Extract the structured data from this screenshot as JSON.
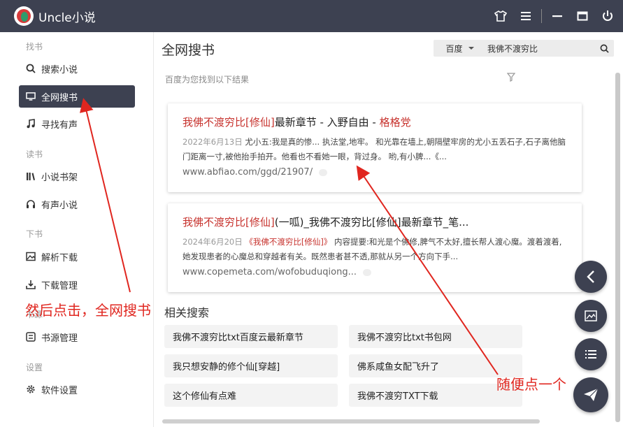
{
  "app": {
    "title": "Uncle小说"
  },
  "sidebar": {
    "sections": [
      {
        "label": "找书"
      },
      {
        "label": "读书"
      },
      {
        "label": "下书"
      },
      {
        "label": "书源"
      },
      {
        "label": "设置"
      }
    ],
    "items": [
      {
        "label": "搜索小说",
        "icon": "search-icon"
      },
      {
        "label": "全网搜书",
        "icon": "monitor-icon",
        "active": true
      },
      {
        "label": "寻找有声",
        "icon": "music-icon"
      },
      {
        "label": "小说书架",
        "icon": "bookshelf-icon"
      },
      {
        "label": "有声小说",
        "icon": "headphones-icon"
      },
      {
        "label": "解析下载",
        "icon": "image-icon"
      },
      {
        "label": "下载管理",
        "icon": "download-icon"
      },
      {
        "label": "书源管理",
        "icon": "source-icon"
      },
      {
        "label": "软件设置",
        "icon": "gear-icon"
      }
    ]
  },
  "main": {
    "title": "全网搜书",
    "search": {
      "engine": "百度",
      "query": "我佛不渡穷比"
    },
    "result_hint": "百度为您找到以下结果",
    "results": [
      {
        "title_hl": "我佛不渡穷比[修仙]",
        "title_rest": "最新章节 - 入野自由 - ",
        "title_author": "格格党",
        "date": "2022年6月13日",
        "desc": " 尤小五:我是真的惨... 执法堂,地牢。 和光靠在墙上,朝隔壁牢房的尤小五丢石子,石子离他脑门距离一寸,被他抬手拍开。他看也不看她一眼，背过身。 哟,有小脾...《...",
        "url": "www.abfiao.com/ggd/21907/"
      },
      {
        "title_hl": "我佛不渡穷比[修仙]",
        "title_rest": "(一呱)_我佛不渡穷比[修仙]最新章节_笔...",
        "title_author": "",
        "date": "2024年6月20日",
        "desc_hl": "《我佛不渡穷比[修仙]》",
        "desc": " 内容提要:和光是个佛修,脾气不太好,擅长帮人渡心魔。渡着渡着,她发现患者的心魔总和穿越者有关。既然患者甚不透,那就从另一个方向下手...",
        "url": "www.copemeta.com/wofobuduqiong..."
      }
    ],
    "related_title": "相关搜索",
    "related": [
      "我佛不渡穷比txt百度云最新章节",
      "我佛不渡穷比txt书包网",
      "我只想安静的修个仙[穿越]",
      "佛系咸鱼女配飞升了",
      "这个修仙有点难",
      "我佛不渡穷TXT下载"
    ]
  },
  "annotations": {
    "left": "然后点击，全网搜书",
    "right": "随便点一个"
  },
  "colors": {
    "dark": "#3d4151",
    "accent": "#c7332e",
    "annotation": "#e0261f"
  }
}
